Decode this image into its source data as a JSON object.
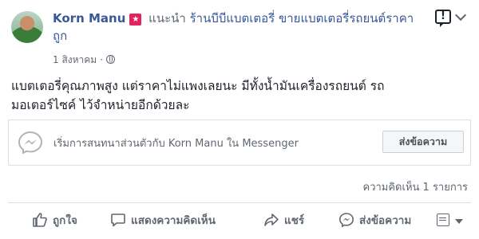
{
  "post": {
    "author": "Korn Manu",
    "recommends_label": "แนะนำ",
    "page_name": "ร้านบีบีแบตเตอรี่ ขายแบตเตอรี่รถยนต์ราคาถูก",
    "date": "1 สิงหาคม",
    "dot": "·",
    "text_line1": "แบตเตอรี่คุณภาพสูง แต่ราคาไม่แพงเลยนะ มีทั้งน้ำมันเครื่องรถยนต์ รถ",
    "text_line2": "มอเตอร์ไซค์ ไว้จำหน่ายอีกด้วยละ",
    "badge_glyph": "★",
    "report_glyph": "!"
  },
  "messenger": {
    "prompt": "เริ่มการสนทนาส่วนตัวกับ Korn Manu ใน Messenger",
    "send_button": "ส่งข้อความ"
  },
  "stats": {
    "comment_count": "ความคิดเห็น 1 รายการ"
  },
  "actions": {
    "like": "ถูกใจ",
    "comment": "แสดงความคิดเห็น",
    "share": "แชร์",
    "message": "ส่งข้อความ"
  },
  "icons": {
    "like": "thumbs-up-icon",
    "comment": "comment-bubble-icon",
    "share": "share-arrow-icon",
    "message": "messenger-icon",
    "globe": "globe-icon"
  },
  "colors": {
    "link": "#385898",
    "muted": "#606770",
    "badge": "#e0245e",
    "messenger_logo": "#b0b3b8"
  }
}
